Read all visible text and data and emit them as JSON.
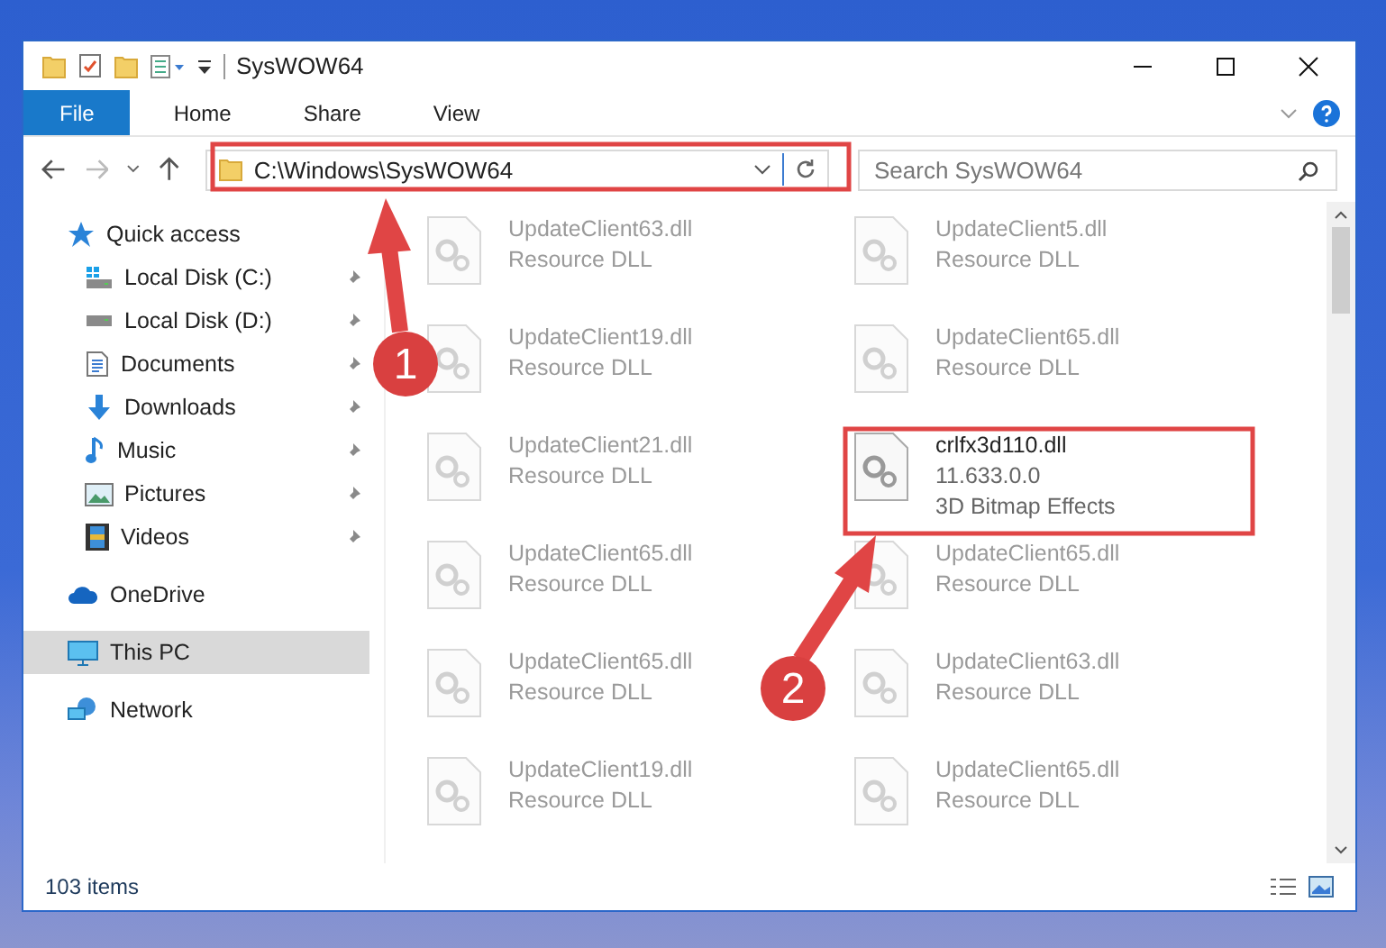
{
  "window": {
    "title": "SysWOW64"
  },
  "ribbon_tabs": [
    {
      "label": "File",
      "selected": true
    },
    {
      "label": "Home",
      "selected": false
    },
    {
      "label": "Share",
      "selected": false
    },
    {
      "label": "View",
      "selected": false
    }
  ],
  "address_bar": {
    "path": "C:\\Windows\\SysWOW64"
  },
  "search": {
    "placeholder": "Search SysWOW64"
  },
  "navigation": [
    {
      "label": "Quick access",
      "kind": "star",
      "selected": false,
      "children": [
        {
          "label": "Local Disk (C:)",
          "kind": "drive-c",
          "pinned": true,
          "selected": false
        },
        {
          "label": "Local Disk (D:)",
          "kind": "drive",
          "pinned": true,
          "selected": false
        },
        {
          "label": "Documents",
          "kind": "documents",
          "pinned": true,
          "selected": false
        },
        {
          "label": "Downloads",
          "kind": "downloads",
          "pinned": true,
          "selected": false
        },
        {
          "label": "Music",
          "kind": "music",
          "pinned": true,
          "selected": false
        },
        {
          "label": "Pictures",
          "kind": "pictures",
          "pinned": true,
          "selected": false
        },
        {
          "label": "Videos",
          "kind": "videos",
          "pinned": true,
          "selected": false
        }
      ]
    },
    {
      "label": "OneDrive",
      "kind": "onedrive",
      "selected": false
    },
    {
      "label": "This PC",
      "kind": "pc",
      "selected": true
    },
    {
      "label": "Network",
      "kind": "network",
      "selected": false
    }
  ],
  "files": [
    {
      "name": "UpdateClient63.dll",
      "details": [
        "Resource DLL"
      ],
      "blurred": true
    },
    {
      "name": "UpdateClient5.dll",
      "details": [
        "Resource DLL"
      ],
      "blurred": true
    },
    {
      "name": "UpdateClient19.dll",
      "details": [
        "Resource DLL"
      ],
      "blurred": true
    },
    {
      "name": "UpdateClient65.dll",
      "details": [
        "Resource DLL"
      ],
      "blurred": true
    },
    {
      "name": "UpdateClient21.dll",
      "details": [
        "Resource DLL"
      ],
      "blurred": true
    },
    {
      "name": "crlfx3d110.dll",
      "details": [
        "11.633.0.0",
        "3D Bitmap Effects"
      ],
      "blurred": false
    },
    {
      "name": "UpdateClient65.dll",
      "details": [
        "Resource DLL"
      ],
      "blurred": true
    },
    {
      "name": "UpdateClient65.dll",
      "details": [
        "Resource DLL"
      ],
      "blurred": true
    },
    {
      "name": "UpdateClient65.dll",
      "details": [
        "Resource DLL"
      ],
      "blurred": true
    },
    {
      "name": "UpdateClient63.dll",
      "details": [
        "Resource DLL"
      ],
      "blurred": true
    },
    {
      "name": "UpdateClient19.dll",
      "details": [
        "Resource DLL"
      ],
      "blurred": true
    },
    {
      "name": "UpdateClient65.dll",
      "details": [
        "Resource DLL"
      ],
      "blurred": true
    }
  ],
  "status_bar": {
    "item_count": "103 items"
  },
  "annotations": [
    {
      "label": "1"
    },
    {
      "label": "2"
    }
  ]
}
